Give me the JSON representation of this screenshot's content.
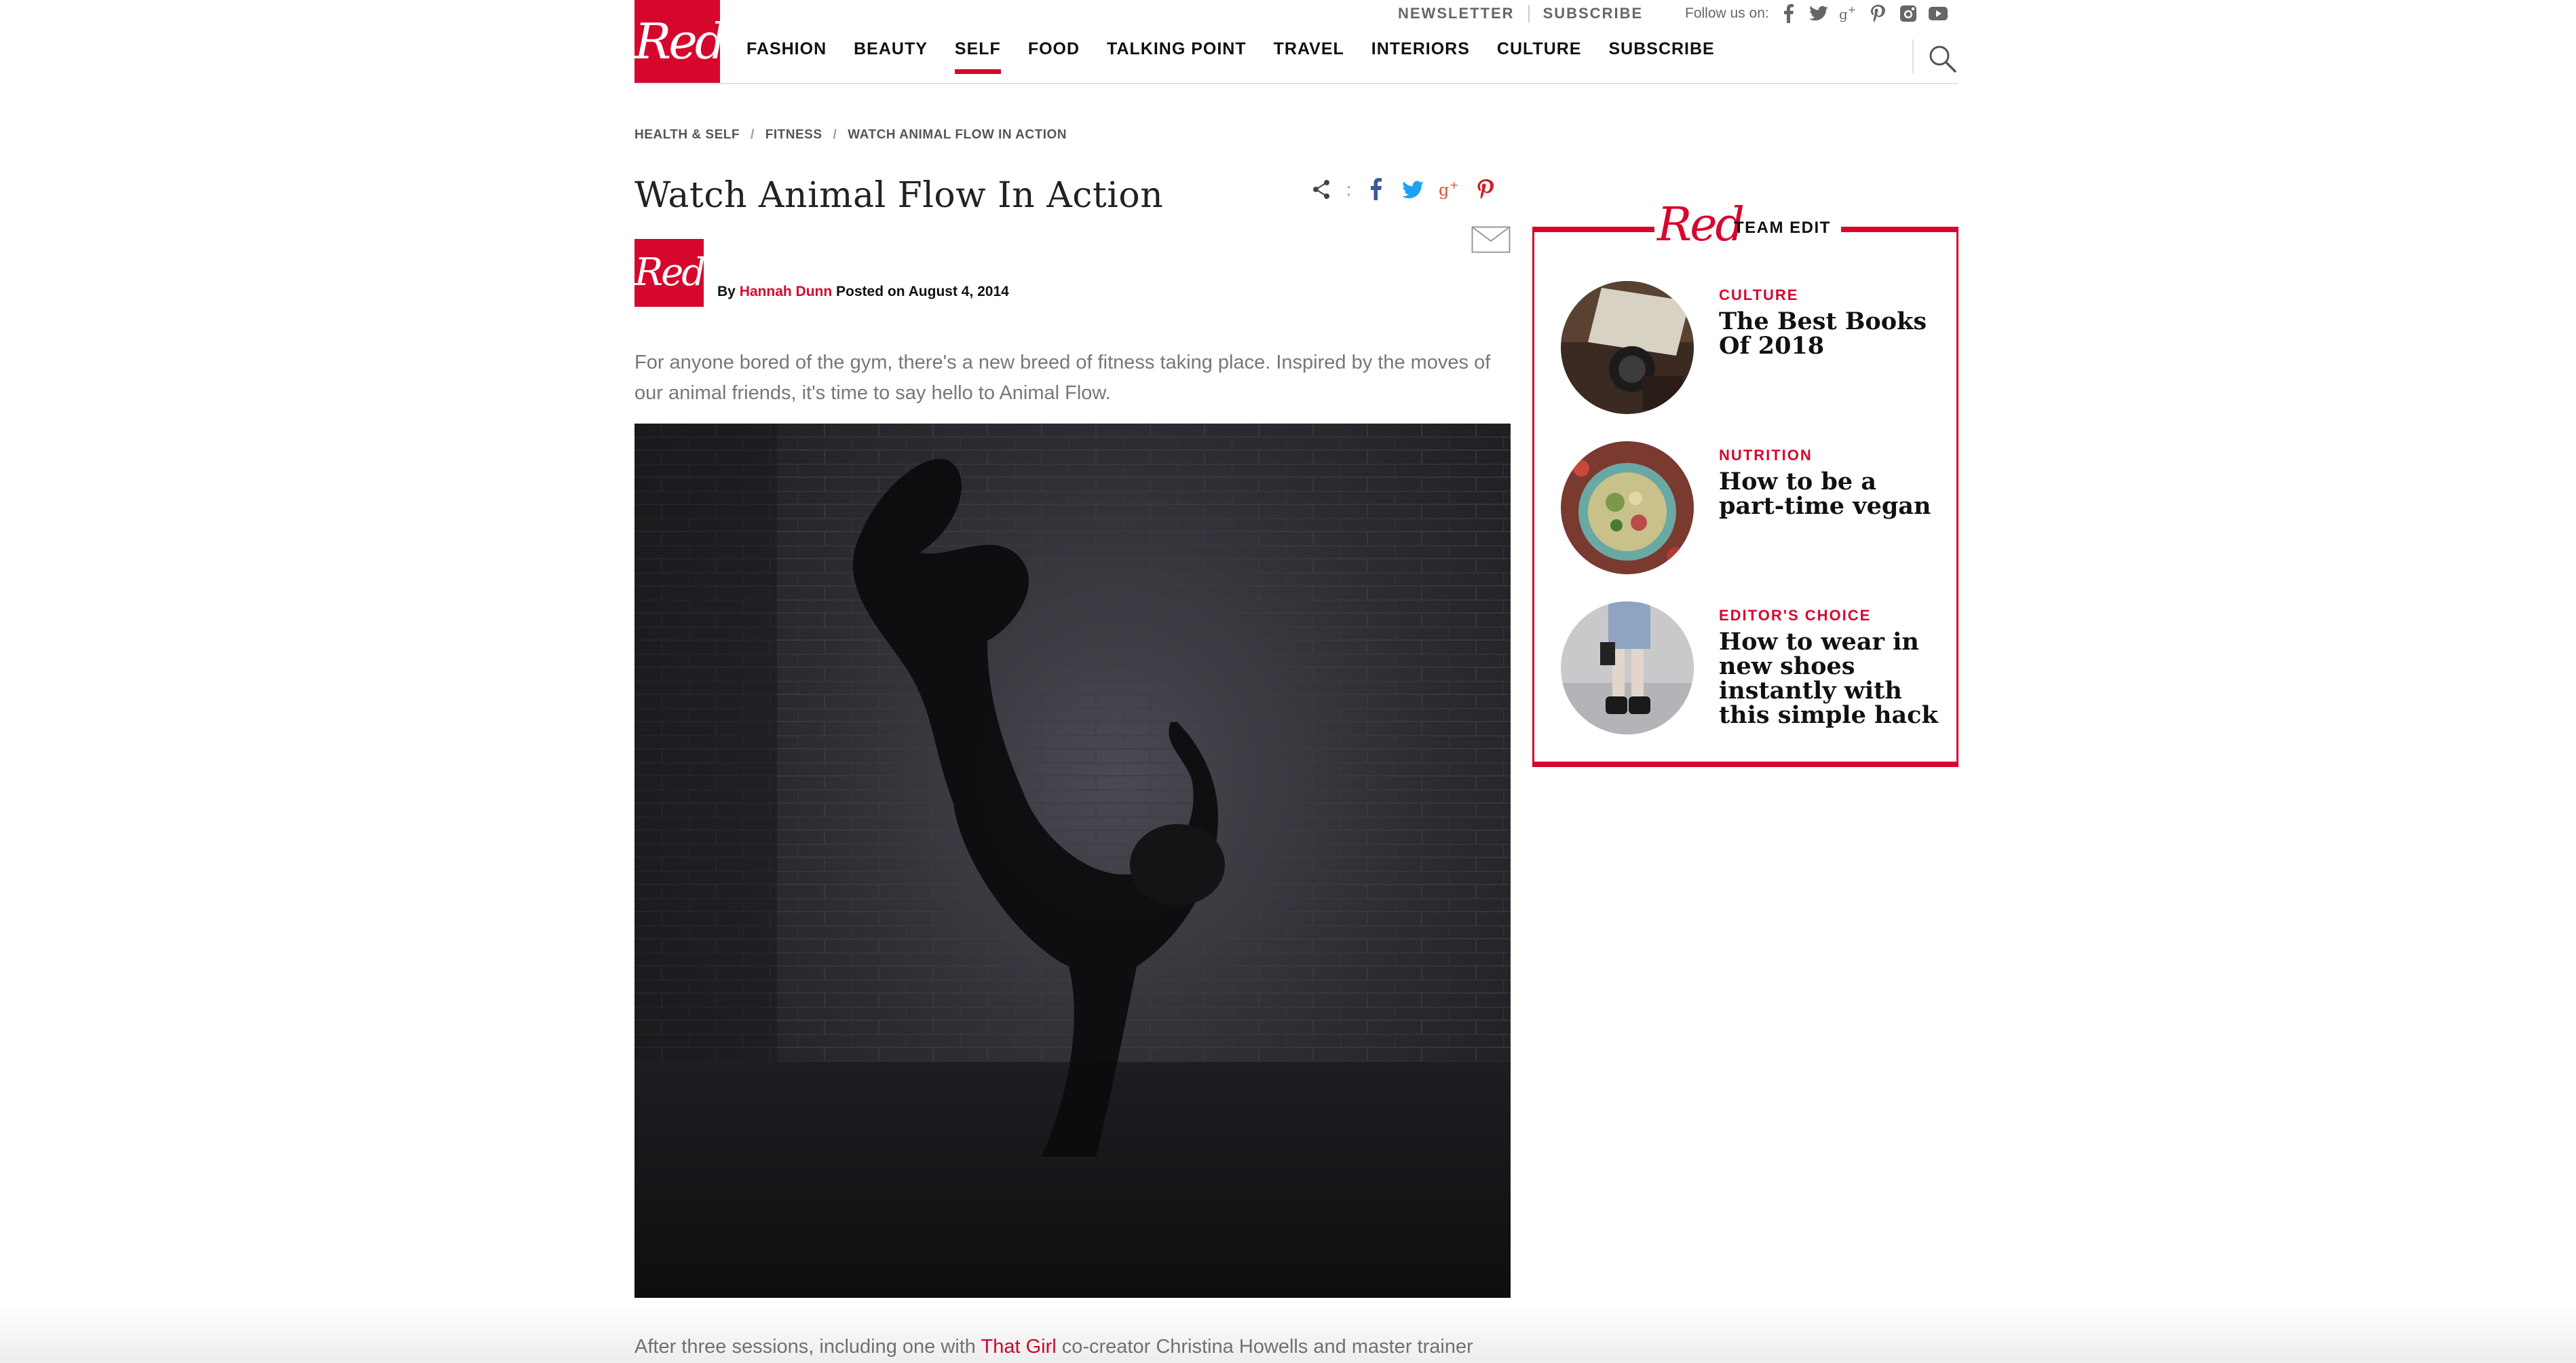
{
  "header": {
    "logo_text": "Red",
    "top_links": [
      "NEWSLETTER",
      "SUBSCRIBE"
    ],
    "follow_label": "Follow us on:",
    "social_icons": [
      "facebook-icon",
      "twitter-icon",
      "google-plus-icon",
      "pinterest-icon",
      "instagram-icon",
      "youtube-icon"
    ],
    "nav": [
      {
        "label": "FASHION",
        "active": false
      },
      {
        "label": "BEAUTY",
        "active": false
      },
      {
        "label": "SELF",
        "active": true
      },
      {
        "label": "FOOD",
        "active": false
      },
      {
        "label": "TALKING POINT",
        "active": false
      },
      {
        "label": "TRAVEL",
        "active": false
      },
      {
        "label": "INTERIORS",
        "active": false
      },
      {
        "label": "CULTURE",
        "active": false
      },
      {
        "label": "SUBSCRIBE",
        "active": false
      }
    ],
    "search_icon": "search-icon"
  },
  "breadcrumb": [
    "HEALTH & SELF",
    "FITNESS",
    "WATCH ANIMAL FLOW IN ACTION"
  ],
  "article": {
    "title": "Watch Animal Flow In Action",
    "share_icons": [
      "share-icon",
      "facebook-icon",
      "twitter-icon",
      "google-plus-icon",
      "pinterest-icon",
      "mail-icon"
    ],
    "share_separator": ":",
    "author_avatar_text": "Red",
    "by_label": "By",
    "author": "Hannah Dunn",
    "posted_label": "Posted on",
    "date": "August 4, 2014",
    "intro": "For anyone bored of the gym, there's a new breed of fitness taking place. Inspired by the moves of our animal friends, it's time to say hello to Animal Flow.",
    "body_before_link": "After three sessions, including one with ",
    "body_link": "That Girl",
    "body_after_link": " co-creator Christina Howells and master trainer"
  },
  "team_edit": {
    "logo_text": "Red",
    "label": "TEAM EDIT",
    "items": [
      {
        "category": "CULTURE",
        "headline": "The Best Books Of 2018"
      },
      {
        "category": "NUTRITION",
        "headline": "How to be a part-time vegan"
      },
      {
        "category": "EDITOR'S CHOICE",
        "headline": "How to wear in new shoes instantly with this simple hack"
      }
    ]
  },
  "colors": {
    "brand_red": "#d6072d",
    "text_dark": "#222222",
    "text_muted": "#777777"
  }
}
